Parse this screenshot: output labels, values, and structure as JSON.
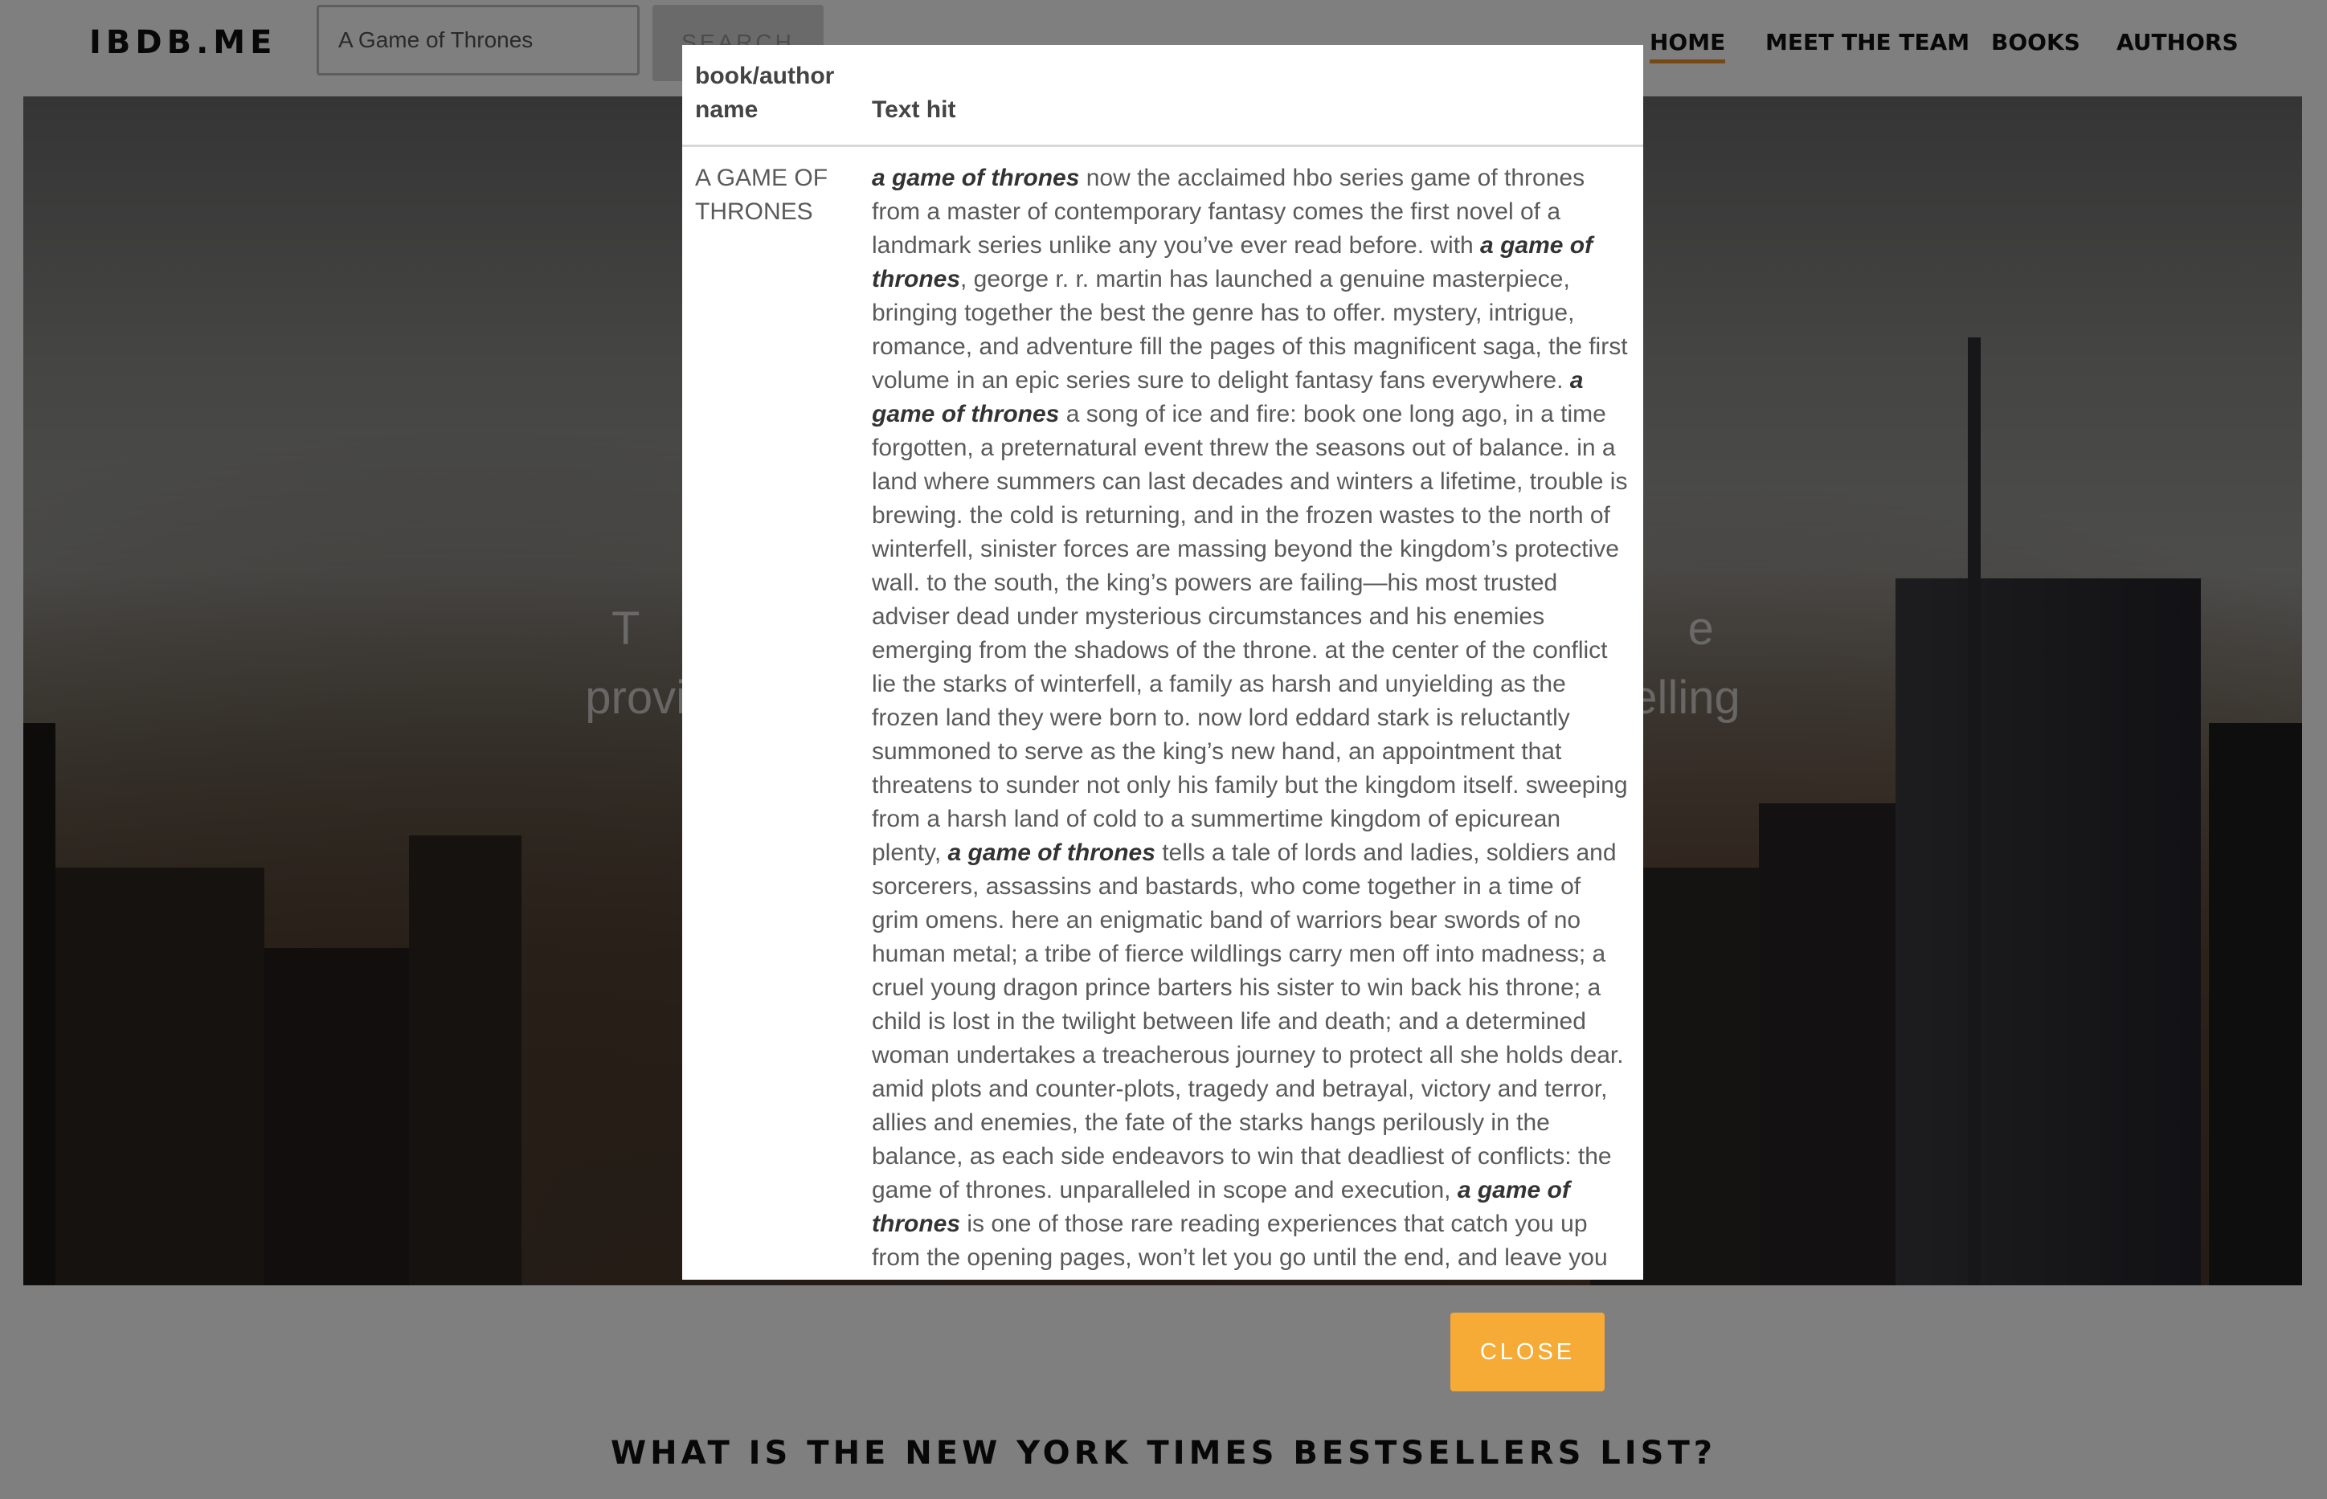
{
  "navbar": {
    "brand": "IBDB.ME",
    "search_value": "A Game of Thrones",
    "search_button": "SEARCH",
    "links": [
      "HOME",
      "MEET THE TEAM",
      "BOOKS",
      "AUTHORS"
    ],
    "active_link": "HOME",
    "active_color": "#e8922b"
  },
  "hero": {
    "line1": "T                                                                                 e",
    "line2": "provi                                                                         elling"
  },
  "section_heading": "WHAT IS THE NEW YORK TIMES BESTSELLERS LIST?",
  "modal": {
    "headers": {
      "name": "book/author name",
      "text": "Text hit"
    },
    "result": {
      "name": "A GAME OF THRONES",
      "segments": [
        {
          "t": "a game of thrones",
          "hit": true
        },
        {
          "t": " now the acclaimed hbo series game of thrones from a master of contemporary fantasy comes the first novel of a landmark series unlike any you’ve ever read before. with ",
          "hit": false
        },
        {
          "t": "a game of thrones",
          "hit": true
        },
        {
          "t": ", george r. r. martin has launched a genuine masterpiece, bringing together the best the genre has to offer. mystery, intrigue, romance, and adventure fill the pages of this magnificent saga, the first volume in an epic series sure to delight fantasy fans everywhere. ",
          "hit": false
        },
        {
          "t": "a game of thrones",
          "hit": true
        },
        {
          "t": " a song of ice and fire: book one long ago, in a time forgotten, a preternatural event threw the seasons out of balance. in a land where summers can last decades and winters a lifetime, trouble is brewing. the cold is returning, and in the frozen wastes to the north of winterfell, sinister forces are massing beyond the kingdom’s protective wall. to the south, the king’s powers are failing—his most trusted adviser dead under mysterious circumstances and his enemies emerging from the shadows of the throne. at the center of the conflict lie the starks of winterfell, a family as harsh and unyielding as the frozen land they were born to. now lord eddard stark is reluctantly summoned to serve as the king’s new hand, an appointment that threatens to sunder not only his family but the kingdom itself. sweeping from a harsh land of cold to a summertime kingdom of epicurean plenty, ",
          "hit": false
        },
        {
          "t": "a game of thrones",
          "hit": true
        },
        {
          "t": " tells a tale of lords and ladies, soldiers and sorcerers, assassins and bastards, who come together in a time of grim omens. here an enigmatic band of warriors bear swords of no human metal; a tribe of fierce wildlings carry men off into madness; a cruel young dragon prince barters his sister to win back his throne; a child is lost in the twilight between life and death; and a determined woman undertakes a treacherous journey to protect all she holds dear. amid plots and counter-plots, tragedy and betrayal, victory and terror, allies and enemies, the fate of the starks hangs perilously in the balance, as each side endeavors to win that deadliest of conflicts: the game of thrones. unparalleled in scope and execution, ",
          "hit": false
        },
        {
          "t": "a game of thrones",
          "hit": true
        },
        {
          "t": " is one of those rare reading experiences that catch you up from the opening pages, won’t let you go until the end, and leave you yearning for more. from the hardcover edition.",
          "hit": false
        }
      ]
    },
    "close_label": "CLOSE",
    "close_color": "#f5ab35"
  }
}
